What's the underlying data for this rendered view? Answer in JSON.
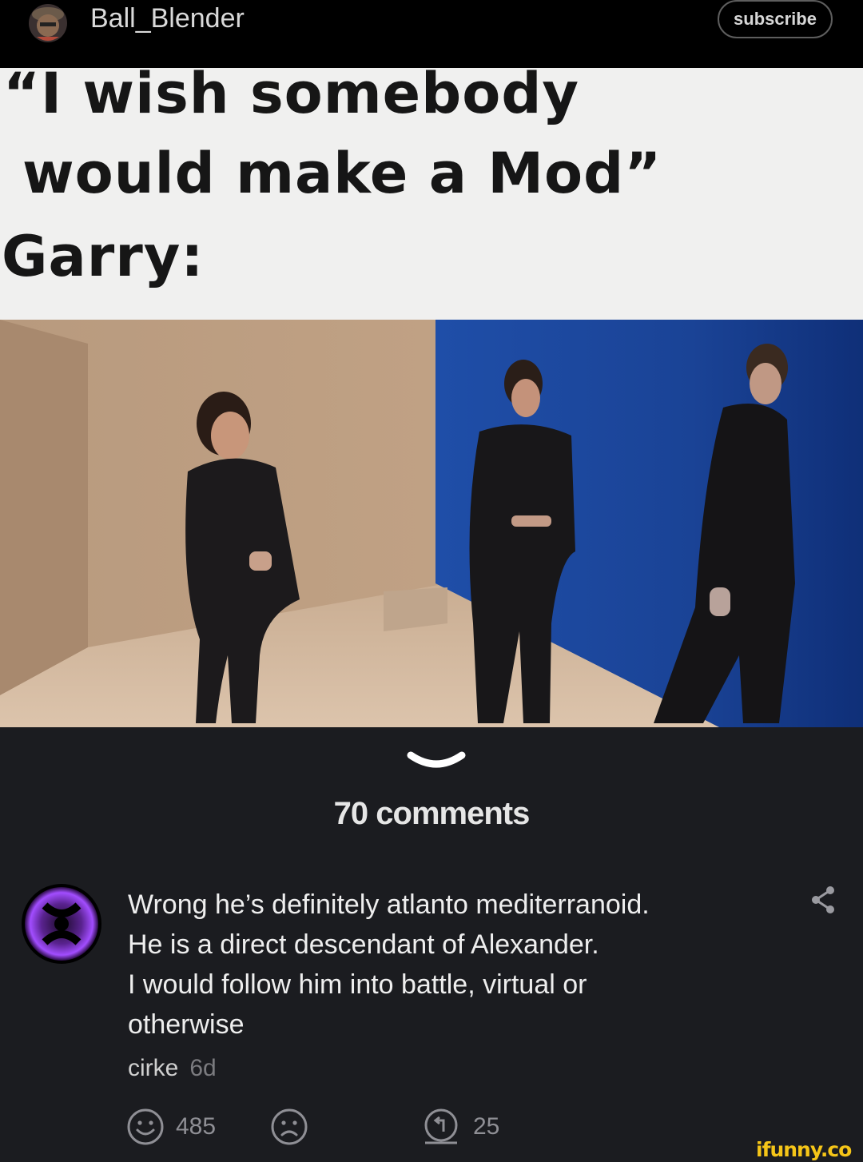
{
  "header": {
    "username": "Ball_Blender",
    "subscribe_label": "subscribe"
  },
  "meme": {
    "caption_lines": [
      "“I wish somebody",
      "would make a Mod”",
      "Garry:"
    ]
  },
  "comments": {
    "count_label": "70 comments",
    "items": [
      {
        "text_lines": [
          "Wrong he’s definitely atlanto mediterranoid.",
          "He is a direct descendant of Alexander.",
          "I would follow him into battle, virtual or",
          "otherwise"
        ],
        "author": "cirke",
        "age": "6d",
        "smile_count": "485",
        "reply_count": "25"
      }
    ]
  },
  "watermark": "ifunny.co",
  "colors": {
    "background": "#1b1c20",
    "header": "#000000",
    "watermark": "#f5c518",
    "avatar_glow": "#a24dff"
  },
  "icons": [
    "user-avatar",
    "chevron-down-icon",
    "comment-avatar",
    "share-icon",
    "smile-icon",
    "frown-icon",
    "reply-icon"
  ]
}
